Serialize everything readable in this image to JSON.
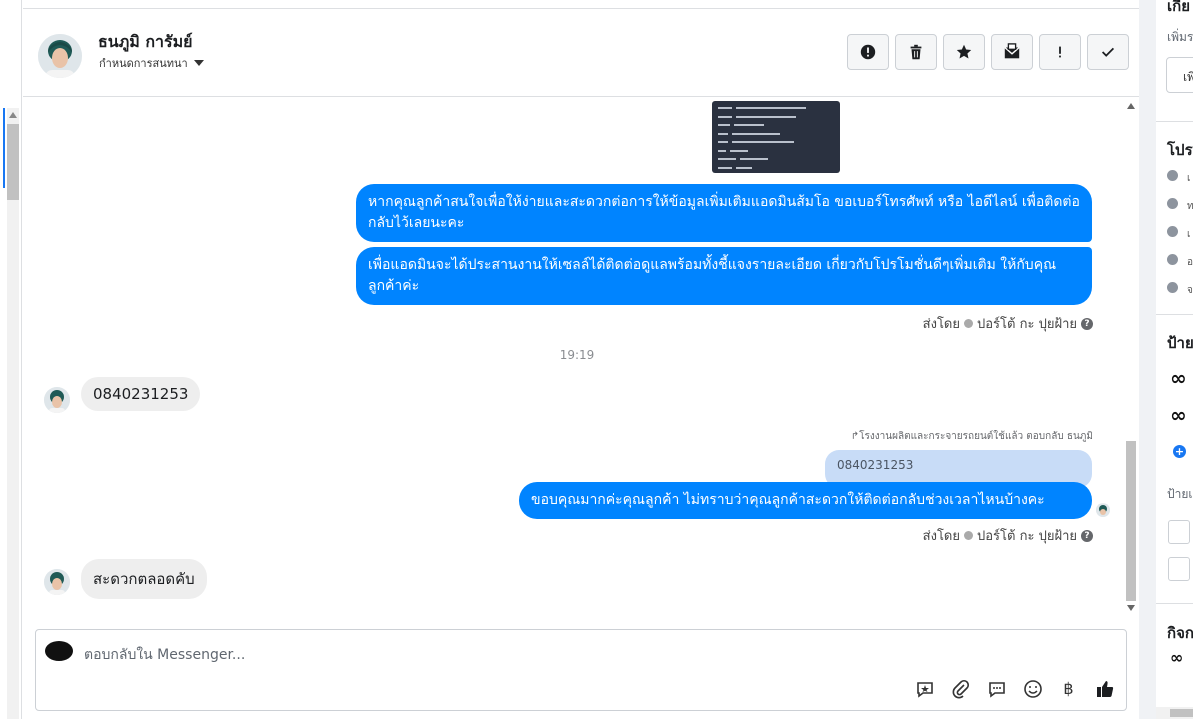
{
  "header": {
    "contact_name": "ธนภูมิ การัมย์",
    "assign_label": "กำหนดการสนทนา",
    "actions": [
      "alert",
      "delete",
      "star",
      "mark-unread",
      "important",
      "done"
    ]
  },
  "messages": {
    "outgoing_1": "หากคุณลูกค้าสนใจเพื่อให้ง่ายและสะดวกต่อการให้ข้อมูลเพิ่มเติมแอดมินส้มโอ ขอเบอร์โทรศัพท์ หรือ ไอดีไลน์ เพื่อติดต่อกลับไว้เลยนะคะ",
    "outgoing_2": "เพื่อแอดมินจะได้ประสานงานให้เซลล์ได้ติดต่อดูแลพร้อมทั้งชี้แจงรายละเอียด เกี่ยวกับโปรโมชั่นดีๆเพิ่มเติม ให้กับคุณลูกค้าค่ะ",
    "sent_by_prefix": "ส่งโดย",
    "sent_by_name": "ปอร์โต้ กะ ปุยฝ้าย",
    "sent_by_help": "?",
    "time_divider": "19:19",
    "incoming_1": "0840231253",
    "reply_context": "โรงงานผลิตและกระจายรถยนต์ใช้แล้ว ตอบกลับ ธนภูมิ",
    "quoted_text": "0840231253",
    "outgoing_3": "ขอบคุณมากค่ะคุณลูกค้า ไม่ทราบว่าคุณลูกค้าสะดวกให้ติดต่อกลับช่วงเวลาไหนบ้างคะ",
    "incoming_2": "สะดวกตลอดคับ"
  },
  "composer": {
    "placeholder": "ตอบกลับใน Messenger...",
    "tools": [
      "saved-reply-icon",
      "attachment-icon",
      "quick-reply-icon",
      "emoji-icon",
      "baht-icon",
      "like-icon"
    ],
    "baht_symbol": "฿"
  },
  "right_panel": {
    "title_1": "เกีย",
    "sub_1": "เพิ่มร",
    "btn_1": "เพิ",
    "title_2": "โปร",
    "details": [
      "เ",
      "ท",
      "เ",
      "อ",
      "จ"
    ],
    "title_3": "ป้าย",
    "sub_3": "ป้ายเ",
    "title_4": "กิจก"
  }
}
